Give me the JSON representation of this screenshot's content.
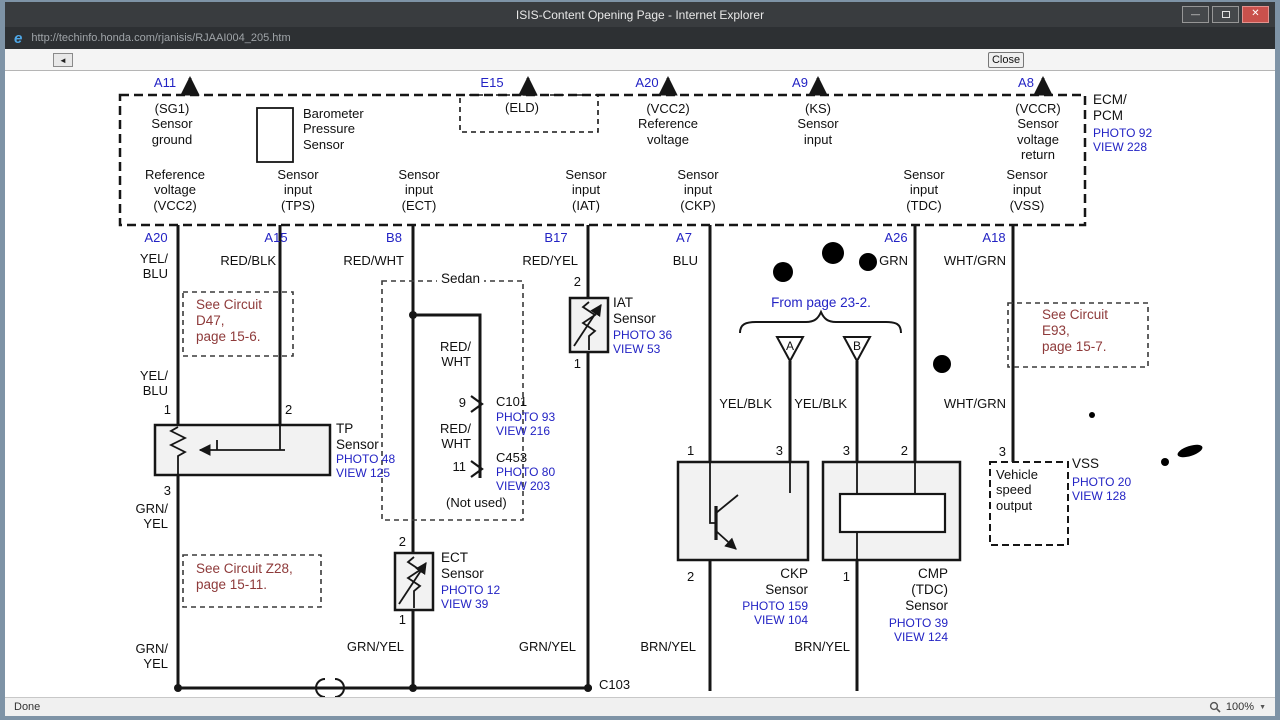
{
  "window": {
    "title": "ISIS-Content Opening Page - Internet Explorer",
    "url": "http://techinfo.honda.com/rjanisis/RJAAI004_205.htm",
    "back_glyph": "◄",
    "close_button": "Close",
    "status": "Done",
    "zoom": "100%"
  },
  "colors": {
    "link_blue": "#2323c4",
    "note_red": "#8e3a3a",
    "line_black": "#161616"
  },
  "diagram": {
    "ecm": {
      "top_pins": [
        "A11",
        "E15",
        "A20",
        "A9",
        "A8"
      ],
      "top_terms": [
        "(SG1)\nSensor\nground",
        "(ELD)",
        "(VCC2)\nReference\nvoltage",
        "(KS)\nSensor\ninput",
        "(VCCR)\nSensor\nvoltage\nreturn"
      ],
      "barometer": "Barometer\nPressure\nSensor",
      "name": "ECM/\nPCM",
      "photo": "PHOTO 92",
      "view": "VIEW 228",
      "bottom_terms": [
        "Reference\nvoltage\n(VCC2)",
        "Sensor\ninput\n(TPS)",
        "Sensor\ninput\n(ECT)",
        "Sensor\ninput\n(IAT)",
        "Sensor\ninput\n(CKP)",
        "Sensor\ninput\n(TDC)",
        "Sensor\ninput\n(VSS)"
      ],
      "bottom_pins": [
        "A20",
        "A15",
        "B8",
        "B17",
        "A7",
        "A26",
        "A18"
      ]
    },
    "wires": {
      "yel_blu_a": "YEL/\nBLU",
      "red_blk": "RED/BLK",
      "red_wht": "RED/WHT",
      "red_yel": "RED/YEL",
      "blu": "BLU",
      "grn": "GRN",
      "wht_grn_a": "WHT/GRN",
      "yel_blu_b": "YEL/\nBLU",
      "grn_yel_a": "GRN/\nYEL",
      "grn_yel_b": "GRN/\nYEL",
      "red_wht_b": "RED/\nWHT",
      "red_wht_c": "RED/\nWHT",
      "grn_yel_c": "GRN/YEL",
      "grn_yel_d": "GRN/YEL",
      "yel_blk_a": "YEL/BLK",
      "yel_blk_b": "YEL/BLK",
      "wht_grn_b": "WHT/GRN",
      "brn_yel_a": "BRN/YEL",
      "brn_yel_b": "BRN/YEL"
    },
    "notes": {
      "d47": "See Circuit\nD47,\npage 15-6.",
      "e93": "See Circuit\nE93,\npage 15-7.",
      "z28": "See Circuit Z28,\npage 15-11.",
      "from_page": "From page 23-2.",
      "sedan": "Sedan",
      "not_used": "(Not used)"
    },
    "sensors": {
      "tp": {
        "name": "TP\nSensor",
        "photo": "PHOTO 48",
        "view": "VIEW 125"
      },
      "ect": {
        "name": "ECT\nSensor",
        "photo": "PHOTO 12",
        "view": "VIEW 39"
      },
      "iat": {
        "name": "IAT\nSensor",
        "photo": "PHOTO 36",
        "view": "VIEW 53"
      },
      "ckp": {
        "name": "CKP\nSensor",
        "photo": "PHOTO 159",
        "view": "VIEW 104"
      },
      "cmp": {
        "name": "CMP\n(TDC)\nSensor",
        "photo": "PHOTO 39",
        "view": "VIEW 124"
      },
      "vss": {
        "name": "VSS",
        "photo": "PHOTO 20",
        "view": "VIEW 128",
        "box": "Vehicle\nspeed\noutput"
      }
    },
    "connectors": {
      "c101": {
        "name": "C101",
        "photo": "PHOTO 93",
        "view": "VIEW 216",
        "pin": "9"
      },
      "c453": {
        "name": "C453",
        "photo": "PHOTO 80",
        "view": "VIEW 203",
        "pin": "11"
      },
      "c103": "C103"
    },
    "pins": {
      "tp1": "1",
      "tp2": "2",
      "tp3": "3",
      "ect_top": "2",
      "ect_bot": "1",
      "iat_top": "2",
      "iat_bot": "1",
      "ckp1": "1",
      "ckp3": "3",
      "ckp2": "2",
      "cmp3": "3",
      "cmp2": "2",
      "cmp1": "1",
      "vss3": "3"
    },
    "triangles": {
      "a": "A",
      "b": "B"
    }
  }
}
